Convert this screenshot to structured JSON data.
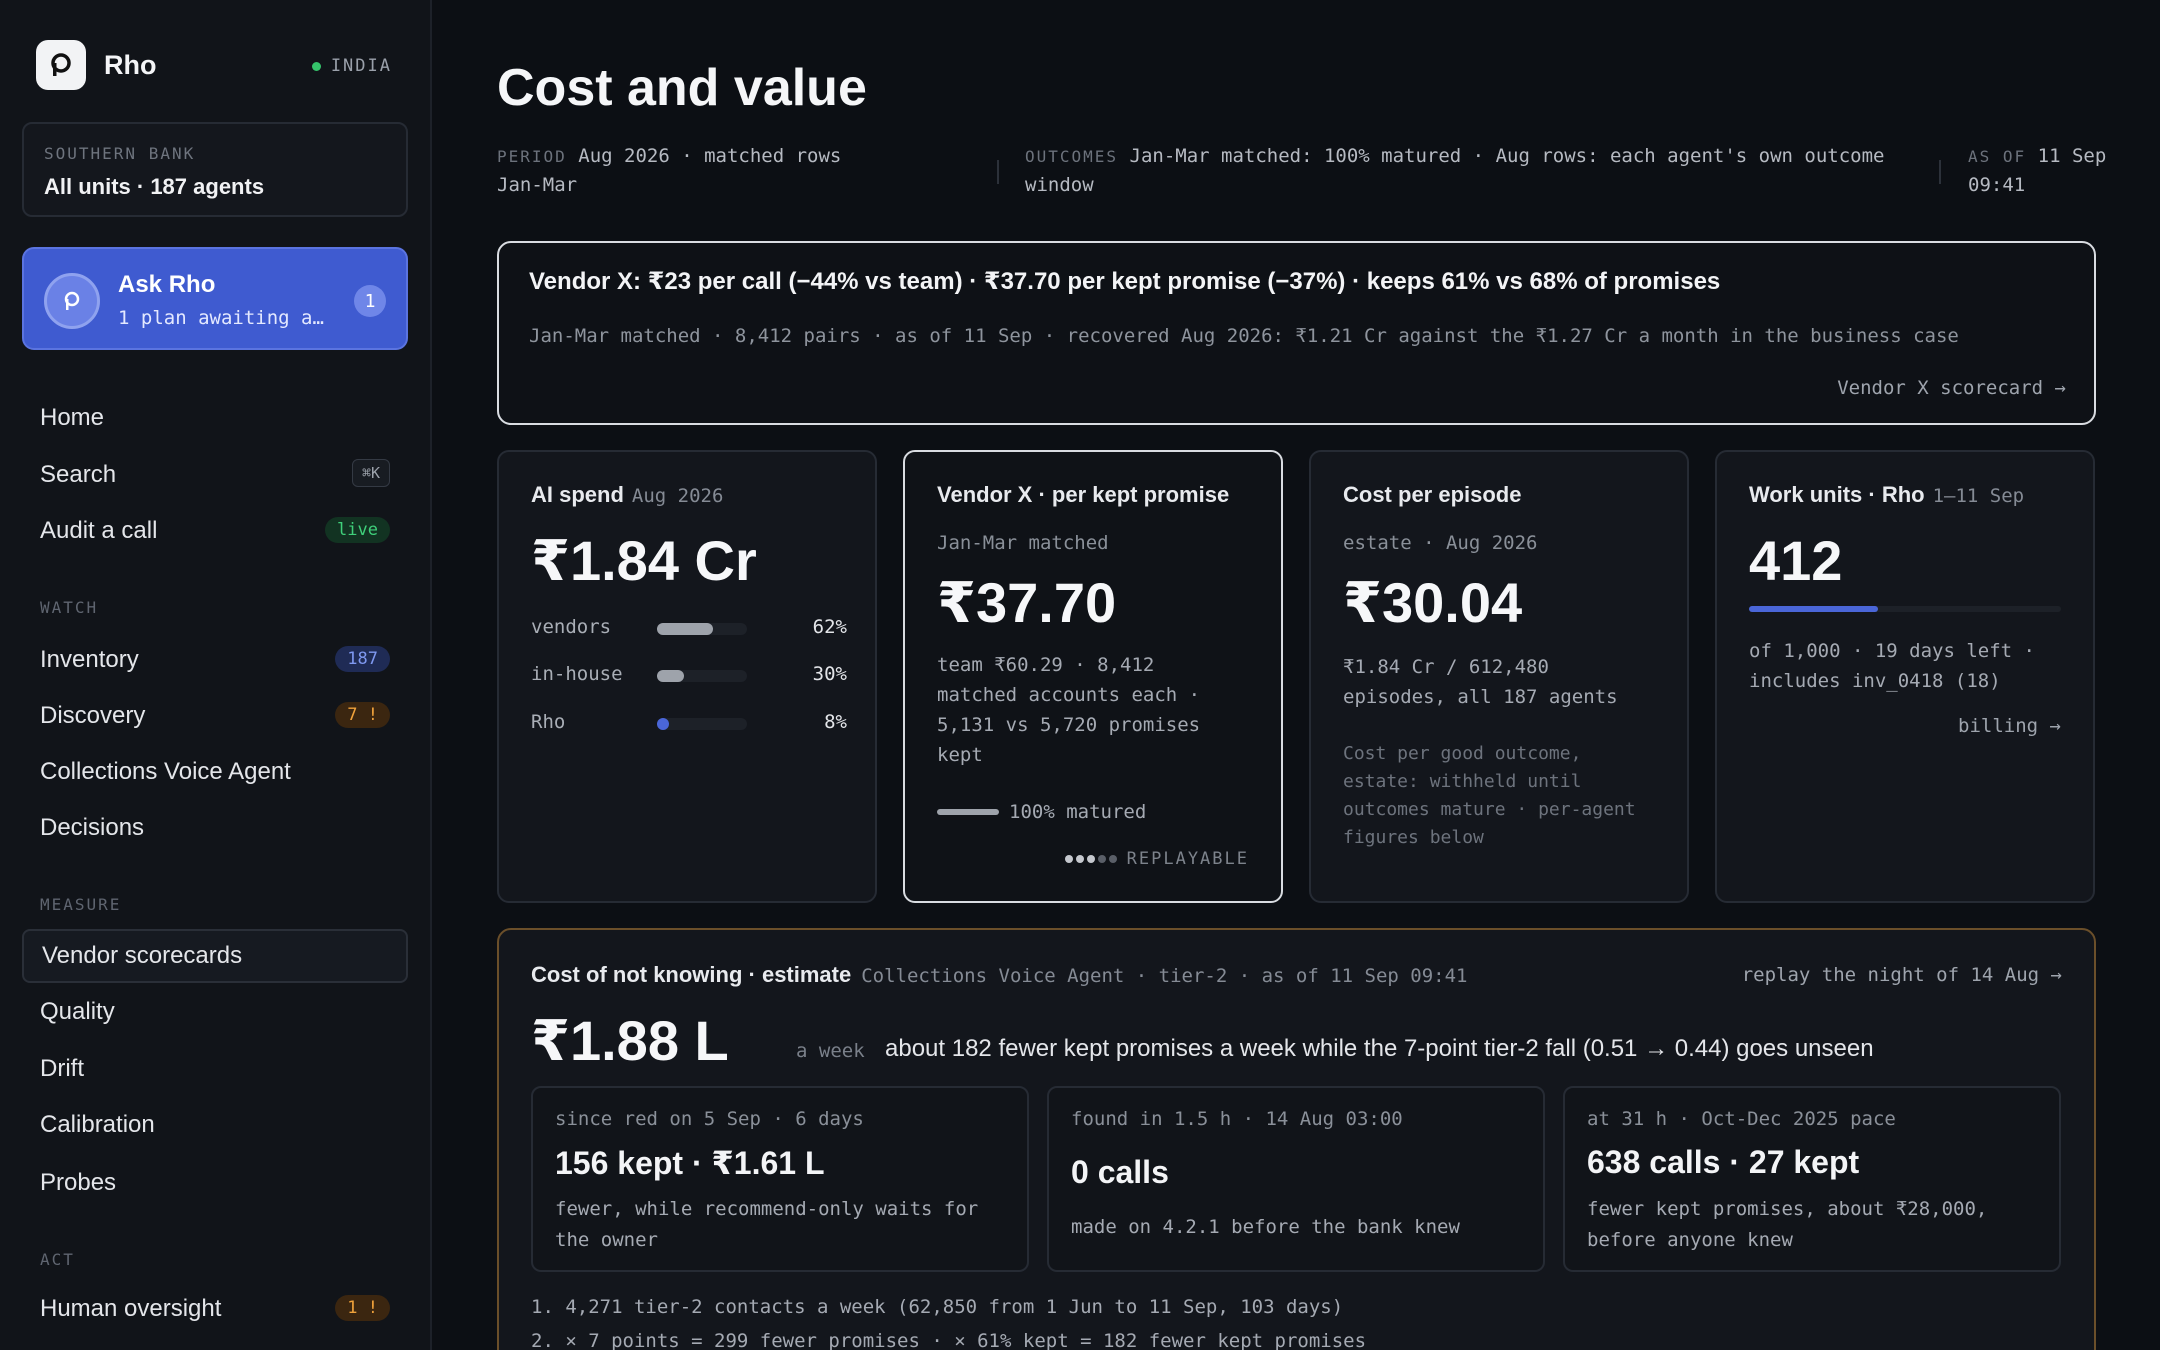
{
  "sidebar": {
    "brand": "Rho",
    "region": "INDIA",
    "org_label": "SOUTHERN BANK",
    "org_value": "All units · 187 agents",
    "ask": {
      "title": "Ask Rho",
      "subtitle": "1 plan awaiting a…",
      "count": "1"
    },
    "nav": [
      {
        "label": "Home"
      },
      {
        "label": "Search",
        "shortcut": "⌘K"
      },
      {
        "label": "Audit a call",
        "badge": "live"
      }
    ],
    "sections": {
      "watch": "WATCH",
      "measure": "MEASURE",
      "act": "ACT"
    },
    "watch_items": [
      {
        "label": "Inventory",
        "badge": "187"
      },
      {
        "label": "Discovery",
        "badge": "7 !"
      },
      {
        "label": "Collections Voice Agent"
      },
      {
        "label": "Decisions"
      }
    ],
    "measure_items": [
      {
        "label": "Vendor scorecards"
      },
      {
        "label": "Quality"
      },
      {
        "label": "Drift"
      },
      {
        "label": "Calibration"
      },
      {
        "label": "Probes"
      }
    ],
    "act_items": [
      {
        "label": "Human oversight",
        "badge": "1 !"
      }
    ]
  },
  "header": {
    "title": "Cost and value",
    "period_label": "PERIOD",
    "period_value_1": "Aug 2026 · matched rows",
    "period_value_2": "Jan-Mar",
    "outcomes_label": "OUTCOMES",
    "outcomes_value_1": "Jan-Mar matched: 100% matured · Aug rows: each agent's own outcome",
    "outcomes_value_2": "window",
    "asof_label": "AS OF",
    "asof_value_1": "11 Sep",
    "asof_value_2": "09:41"
  },
  "summary": {
    "headline": "Vendor X: ₹23 per call (−44% vs team) · ₹37.70 per kept promise (−37%) · keeps 61% vs 68% of promises",
    "detail": "Jan-Mar matched · 8,412 pairs · as of 11 Sep · recovered Aug 2026: ₹1.21 Cr against the ₹1.27 Cr a month in the business case",
    "link": "Vendor X scorecard →"
  },
  "cards": {
    "ai_spend": {
      "title": "AI spend",
      "sub": "Aug 2026",
      "value": "₹1.84 Cr",
      "bars": [
        {
          "label": "vendors",
          "pct": "62%",
          "fraction": 0.62,
          "color": "#9ea3ab"
        },
        {
          "label": "in-house",
          "pct": "30%",
          "fraction": 0.3,
          "color": "#9ea3ab"
        },
        {
          "label": "Rho",
          "pct": "8%",
          "fraction": 0.08,
          "color": "#4a66d8"
        }
      ]
    },
    "vendor_x": {
      "title": "Vendor X · per kept promise",
      "kicker": "Jan-Mar matched",
      "value": "₹37.70",
      "text_1": "team ₹60.29 · 8,412",
      "text_2": "matched accounts each ·",
      "text_3": "5,131 vs 5,720 promises",
      "text_4": "kept",
      "matured": "100% matured",
      "replay": "REPLAYABLE"
    },
    "episode": {
      "title": "Cost per episode",
      "kicker": "estate · Aug 2026",
      "value": "₹30.04",
      "text_1": "₹1.84 Cr / 612,480",
      "text_2": "episodes, all 187 agents",
      "faint_1": "Cost per good outcome,",
      "faint_2": "estate: withheld until",
      "faint_3": "outcomes mature · per-agent",
      "faint_4": "figures below"
    },
    "work_units": {
      "title": "Work units · Rho",
      "sub": "1–11 Sep",
      "value": "412",
      "progress": 0.412,
      "text_1": "of 1,000 · 19 days left ·",
      "text_2": "includes inv_0418 (18)",
      "link": "billing →"
    }
  },
  "lower": {
    "title": "Cost of not knowing · estimate",
    "sub": "Collections Voice Agent · tier-2 · as of 11 Sep 09:41",
    "link": "replay the night of 14 Aug →",
    "value": "₹1.88 L",
    "unit": "a week",
    "desc": "about 182 fewer kept promises a week while the 7-point tier-2 fall (0.51 → 0.44) goes unseen",
    "minis": [
      {
        "kicker": "since red on 5 Sep · 6 days",
        "big": "156 kept · ₹1.61 L",
        "text_1": "fewer, while recommend-only waits for",
        "text_2": "the owner"
      },
      {
        "kicker": "found in 1.5 h · 14 Aug 03:00",
        "big": "0 calls",
        "text_1": "made on 4.2.1 before the bank knew",
        "text_2": ""
      },
      {
        "kicker": "at 31 h · Oct-Dec 2025 pace",
        "big": "638 calls · 27 kept",
        "text_1": "fewer kept promises, about ₹28,000,",
        "text_2": "before anyone knew"
      }
    ],
    "steps": [
      "1. 4,271 tier-2 contacts a week (62,850 from 1 Jun to 11 Sep, 103 days)",
      "2. × 7 points = 299 fewer promises · × 61% kept = 182 fewer kept promises"
    ]
  }
}
